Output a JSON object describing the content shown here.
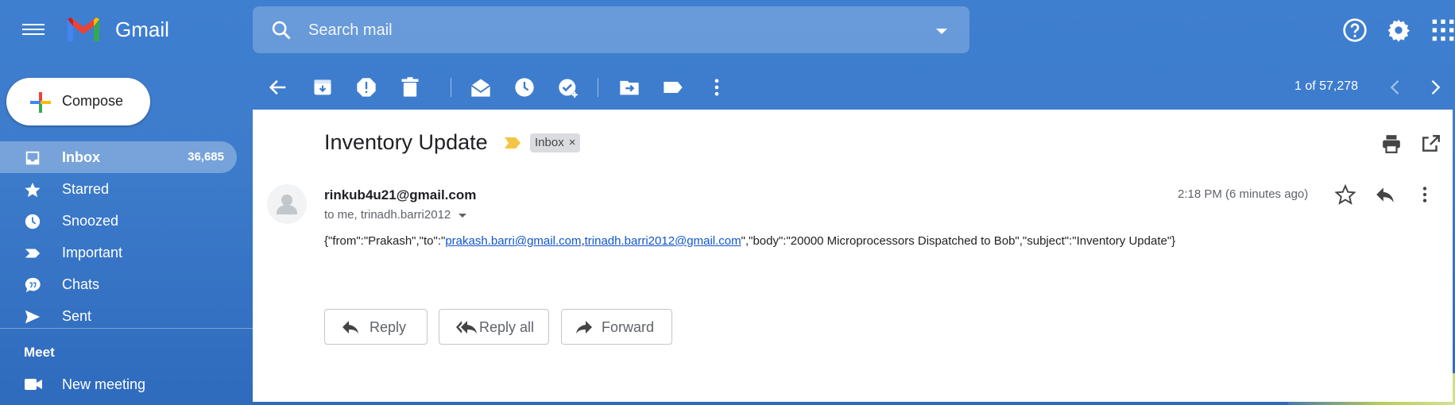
{
  "header": {
    "brand": "Gmail",
    "search_placeholder": "Search mail"
  },
  "sidebar": {
    "compose_label": "Compose",
    "items": [
      {
        "label": "Inbox",
        "count": "36,685",
        "icon": "inbox-icon",
        "active": true
      },
      {
        "label": "Starred",
        "count": "",
        "icon": "star-icon"
      },
      {
        "label": "Snoozed",
        "count": "",
        "icon": "clock-icon"
      },
      {
        "label": "Important",
        "count": "",
        "icon": "important-icon"
      },
      {
        "label": "Chats",
        "count": "",
        "icon": "chat-icon"
      },
      {
        "label": "Sent",
        "count": "",
        "icon": "send-icon"
      }
    ],
    "meet_title": "Meet",
    "new_meeting_label": "New meeting"
  },
  "toolbar": {
    "pager": "1 of 57,278"
  },
  "email": {
    "subject": "Inventory Update",
    "label_chip": "Inbox",
    "label_remove": "×",
    "sender": "rinkub4u21@gmail.com",
    "recipients": "to me, trinadh.barri2012",
    "time": "2:18 PM (6 minutes ago)",
    "body_prefix": "{\"from\":\"Prakash\",\"to\":\"",
    "link1": "prakash.barri@gmail.com",
    "link_sep": ",",
    "link2": "trinadh.barri2012@gmail.com",
    "body_suffix": "\",\"body\":\"20000 Microprocessors Dispatched to Bob\",\"subject\":\"Inventory Update\"}"
  },
  "actions": {
    "reply": "Reply",
    "reply_all": "Reply all",
    "forward": "Forward"
  },
  "colors": {
    "background": "#3d7bcb",
    "link": "#1155cc",
    "important_marker": "#f4c542"
  }
}
